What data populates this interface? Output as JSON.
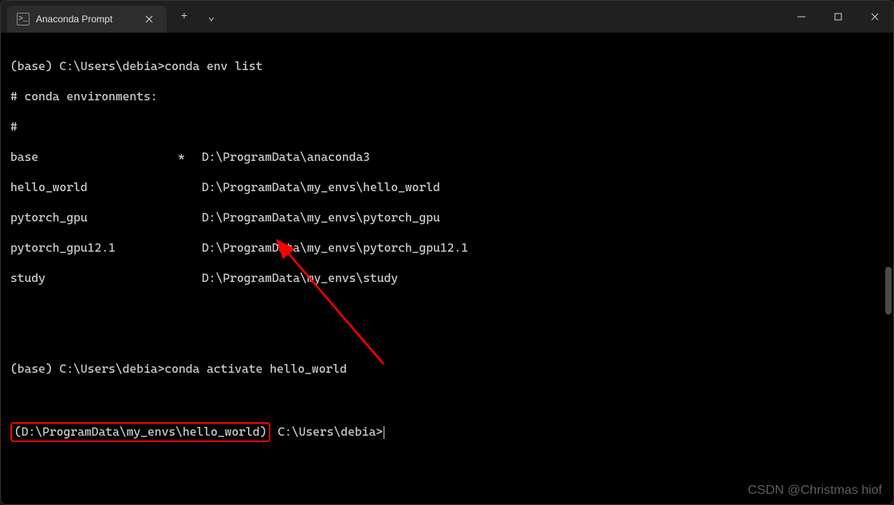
{
  "titlebar": {
    "tab_title": "Anaconda Prompt",
    "tab_icon_text": "C:\\",
    "new_tab_symbol": "+",
    "dropdown_symbol": "⌄"
  },
  "terminal": {
    "prompt1_prefix": "(base) C:\\Users\\debia>",
    "command1": "conda env list",
    "header_line": "# conda environments:",
    "hash_line": "#",
    "envs": [
      {
        "name": "base",
        "active": "*",
        "path": "D:\\ProgramData\\anaconda3"
      },
      {
        "name": "hello_world",
        "active": "",
        "path": "D:\\ProgramData\\my_envs\\hello_world"
      },
      {
        "name": "pytorch_gpu",
        "active": "",
        "path": "D:\\ProgramData\\my_envs\\pytorch_gpu"
      },
      {
        "name": "pytorch_gpu12.1",
        "active": "",
        "path": "D:\\ProgramData\\my_envs\\pytorch_gpu12.1"
      },
      {
        "name": "study",
        "active": "",
        "path": "D:\\ProgramData\\my_envs\\study"
      }
    ],
    "prompt2_prefix": "(base) C:\\Users\\debia>",
    "command2": "conda activate hello_world",
    "prompt3_env": "(D:\\ProgramData\\my_envs\\hello_world)",
    "prompt3_path": " C:\\Users\\debia>"
  },
  "watermark": "CSDN @Christmas hiof"
}
